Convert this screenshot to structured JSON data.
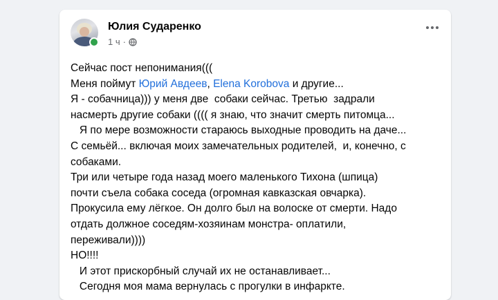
{
  "post": {
    "author": "Юлия Сударенко",
    "time": "1 ч",
    "visibility_icon": "globe-icon",
    "menu_icon": "more-horizontal-icon",
    "colors": {
      "link": "#216fdb",
      "online": "#31a24c",
      "text": "#050505",
      "meta": "#65676b"
    },
    "lines": {
      "l1": "Сейчас пост непонимания(((",
      "l2_pre": "Меня поймут ",
      "l2_link1": "Юрий Авдеев",
      "l2_sep": ", ",
      "l2_link2": "Elena Korobova",
      "l2_post": " и другие...",
      "l3": "Я - собачница))) у меня две  собаки сейчас. Третью  задрали",
      "l4": "насмерть другие собаки (((( я знаю, что значит смерть питомца...",
      "l5": "   Я по мере возможности стараюсь выходные проводить на даче...",
      "l6": "С семьёй... включая моих замечательных родителей,  и, конечно, с",
      "l7": "собаками.",
      "l8": "Три или четыре года назад моего маленького Тихона (шпица)",
      "l9": "почти съела собака соседа (огромная кавказская овчарка).",
      "l10": "Прокусила ему лёгкое. Он долго был на волоске от смерти. Надо",
      "l11": "отдать должное соседям-хозяинам монстра- оплатили,",
      "l12": "переживали))))",
      "l13": "НО!!!!",
      "l14": "   И этот прискорбный случай их не останавливает...",
      "l15": "   Сегодня моя мама вернулась с прогулки в инфаркте."
    }
  }
}
